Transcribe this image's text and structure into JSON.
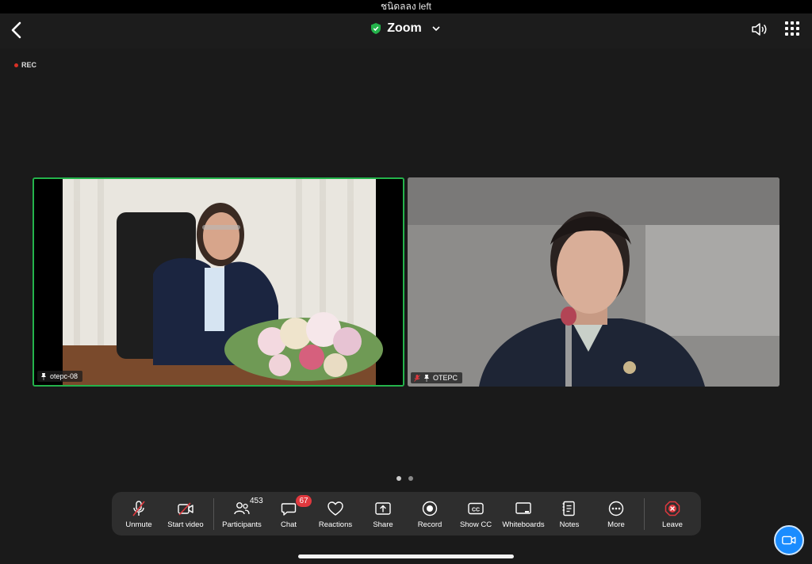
{
  "status_bar": {
    "text": "ชนิดลลง left"
  },
  "header": {
    "title": "Zoom"
  },
  "recording": {
    "label": "REC"
  },
  "participants": [
    {
      "name": "otepc-08",
      "active_speaker": true,
      "pinned": true,
      "muted": false
    },
    {
      "name": "OTEPC",
      "active_speaker": false,
      "pinned": true,
      "muted": true
    }
  ],
  "pagination": {
    "pages": 2,
    "current": 1
  },
  "toolbar": {
    "unmute": "Unmute",
    "start_video": "Start video",
    "participants": "Participants",
    "participants_count": "453",
    "chat": "Chat",
    "chat_badge": "67",
    "reactions": "Reactions",
    "share": "Share",
    "record": "Record",
    "show_cc": "Show CC",
    "whiteboards": "Whiteboards",
    "notes": "Notes",
    "more": "More",
    "leave": "Leave"
  },
  "colors": {
    "active_border": "#24b34b",
    "leave_red": "#e0383e",
    "fab_blue": "#1a8cff"
  }
}
